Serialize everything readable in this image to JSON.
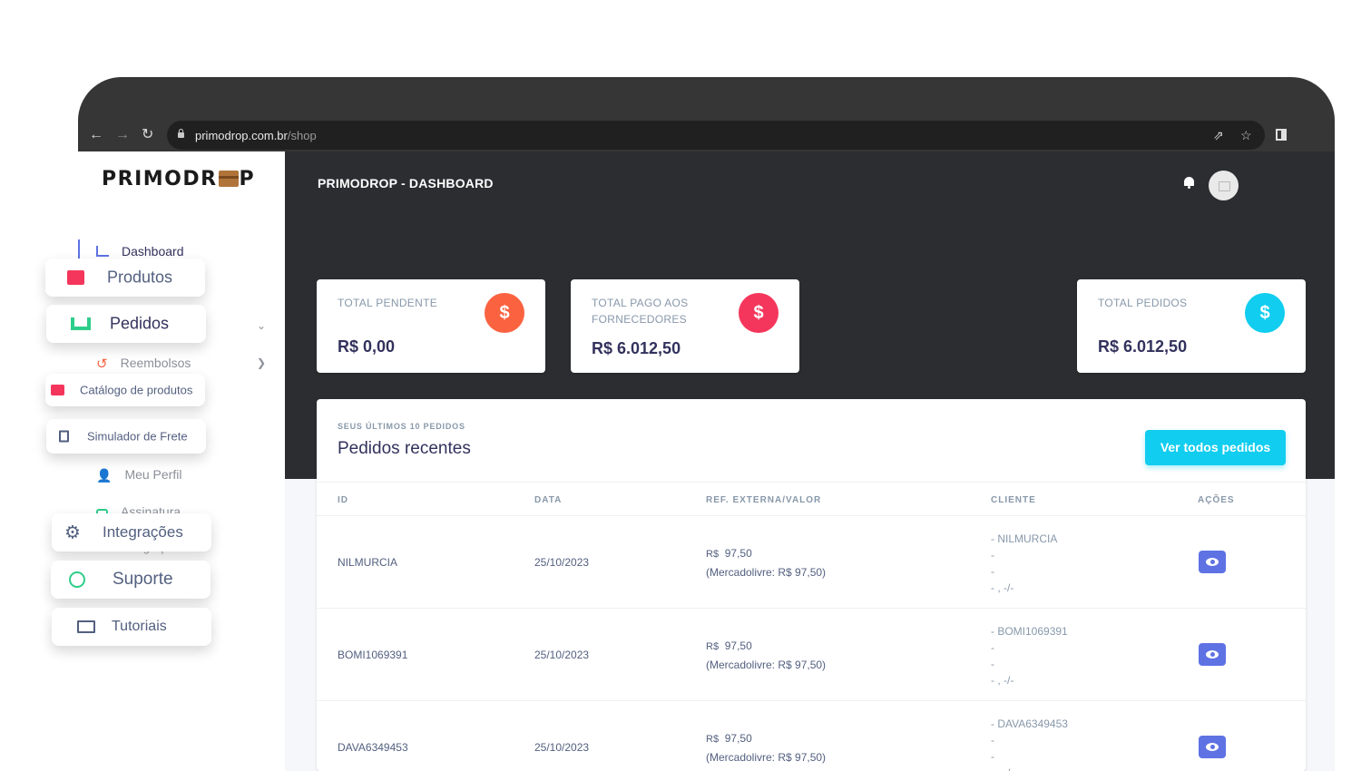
{
  "browser": {
    "url_host": "primodrop.com.br",
    "url_path": "/shop"
  },
  "brand": {
    "logo_text_left": "PRIMODR",
    "logo_text_right": "P"
  },
  "header": {
    "title": "PRIMODROP - DASHBOARD"
  },
  "sidebar": {
    "dashboard": "Dashboard",
    "reembolsos": "Reembolsos",
    "meu_perfil": "Meu Perfil",
    "assinatura": "Assinatura",
    "integracoes_hidden": "Integrações"
  },
  "floating_menu": {
    "produtos": "Produtos",
    "pedidos": "Pedidos",
    "catalogo": "Catálogo de produtos",
    "simulador": "Simulador de Frete",
    "integracoes": "Integrações",
    "suporte": "Suporte",
    "tutoriais": "Tutoriais"
  },
  "stats": [
    {
      "label": "TOTAL PENDENTE",
      "value": "R$ 0,00",
      "icon": "$",
      "color": "#fb6340"
    },
    {
      "label": "TOTAL PAGO AOS FORNECEDORES",
      "value": "R$ 6.012,50",
      "icon": "$",
      "color": "#f5365c"
    },
    {
      "label": "TOTAL PEDIDOS",
      "value": "R$ 6.012,50",
      "icon": "$",
      "color": "#11cdef"
    }
  ],
  "orders": {
    "subtitle": "SEUS ÚLTIMOS 10 PEDIDOS",
    "title": "Pedidos recentes",
    "button": "Ver todos pedidos",
    "columns": [
      "ID",
      "DATA",
      "REF. EXTERNA/VALOR",
      "CLIENTE",
      "AÇÕES"
    ],
    "rows": [
      {
        "id": "NILMURCIA",
        "date": "25/10/2023",
        "currency": "R$",
        "amount": "97,50",
        "ref": "(Mercadolivre: R$ 97,50)",
        "client_lines": [
          "- NILMURCIA",
          "-",
          "-",
          "- , -/-"
        ]
      },
      {
        "id": "BOMI1069391",
        "date": "25/10/2023",
        "currency": "R$",
        "amount": "97,50",
        "ref": "(Mercadolivre: R$ 97,50)",
        "client_lines": [
          "- BOMI1069391",
          "-",
          "-",
          "- , -/-"
        ]
      },
      {
        "id": "DAVA6349453",
        "date": "25/10/2023",
        "currency": "R$",
        "amount": "97,50",
        "ref": "(Mercadolivre: R$ 97,50)",
        "client_lines": [
          "- DAVA6349453",
          "-",
          "-",
          "- , -/-"
        ]
      }
    ]
  },
  "colors": {
    "accent": "#5e72e4",
    "info": "#11cdef",
    "warning": "#fb6340",
    "danger": "#f5365c",
    "dark": "#2b2d31"
  }
}
